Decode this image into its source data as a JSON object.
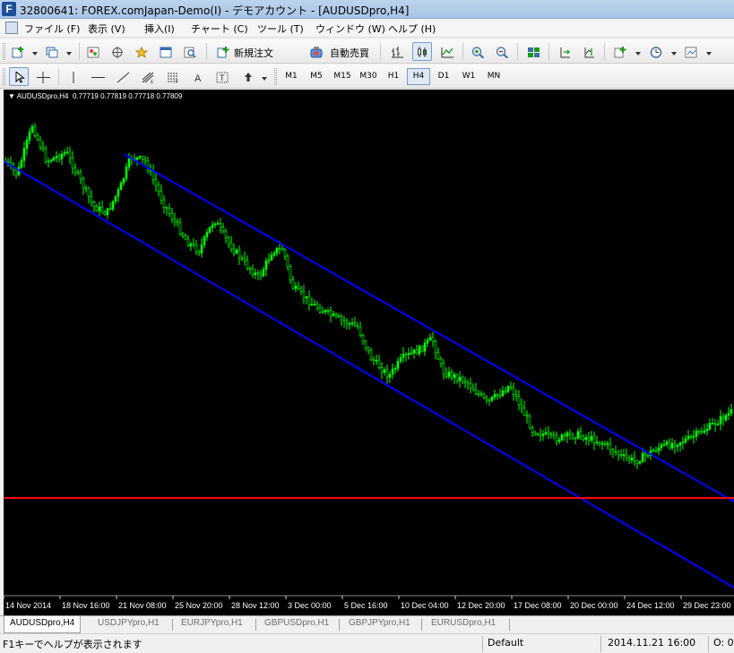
{
  "window": {
    "title": "32800641: FOREX.comJapan-Demo(I) - デモアカウント - [AUDUSDpro,H4]",
    "app_icon": "F"
  },
  "menu": [
    "ファイル (F)",
    "表示 (V)",
    "挿入(I)",
    "チャート (C)",
    "ツール (T)",
    "ウィンドウ (W)",
    "ヘルプ (H)"
  ],
  "toolbar": {
    "new_order_label": "新規注文",
    "auto_trading_label": "自動売買"
  },
  "timeframes": [
    "M1",
    "M5",
    "M15",
    "M30",
    "H1",
    "H4",
    "D1",
    "W1",
    "MN"
  ],
  "active_timeframe": "H4",
  "chart": {
    "symbol_label": "AUDUSDpro,H4",
    "ohlc_label": "0.77719 0.77819 0.77718 0.77809",
    "background": "#000000",
    "candle_color": "#00ff00",
    "channel_color": "#0000ff",
    "hline_color": "#ff0000",
    "x_labels": [
      "14 Nov 2014",
      "18 Nov 16:00",
      "21 Nov 08:00",
      "25 Nov 20:00",
      "28 Nov 12:00",
      "3 Dec 00:00",
      "5 Dec 16:00",
      "10 Dec 04:00",
      "12 Dec 20:00",
      "17 Dec 08:00",
      "20 Dec 00:00",
      "24 Dec 12:00",
      "29 Dec 23:00"
    ]
  },
  "tabs": [
    "AUDUSDpro,H4",
    "USDJPYpro,H1",
    "EURJPYpro,H1",
    "GBPUSDpro,H1",
    "GBPJPYpro,H1",
    "EURUSDpro,H1"
  ],
  "active_tab": "AUDUSDpro,H4",
  "status": {
    "help": "F1キーでヘルプが表示されます",
    "profile": "Default",
    "datetime": "2014.11.21 16:00",
    "ohlc_o": "O: 0"
  }
}
